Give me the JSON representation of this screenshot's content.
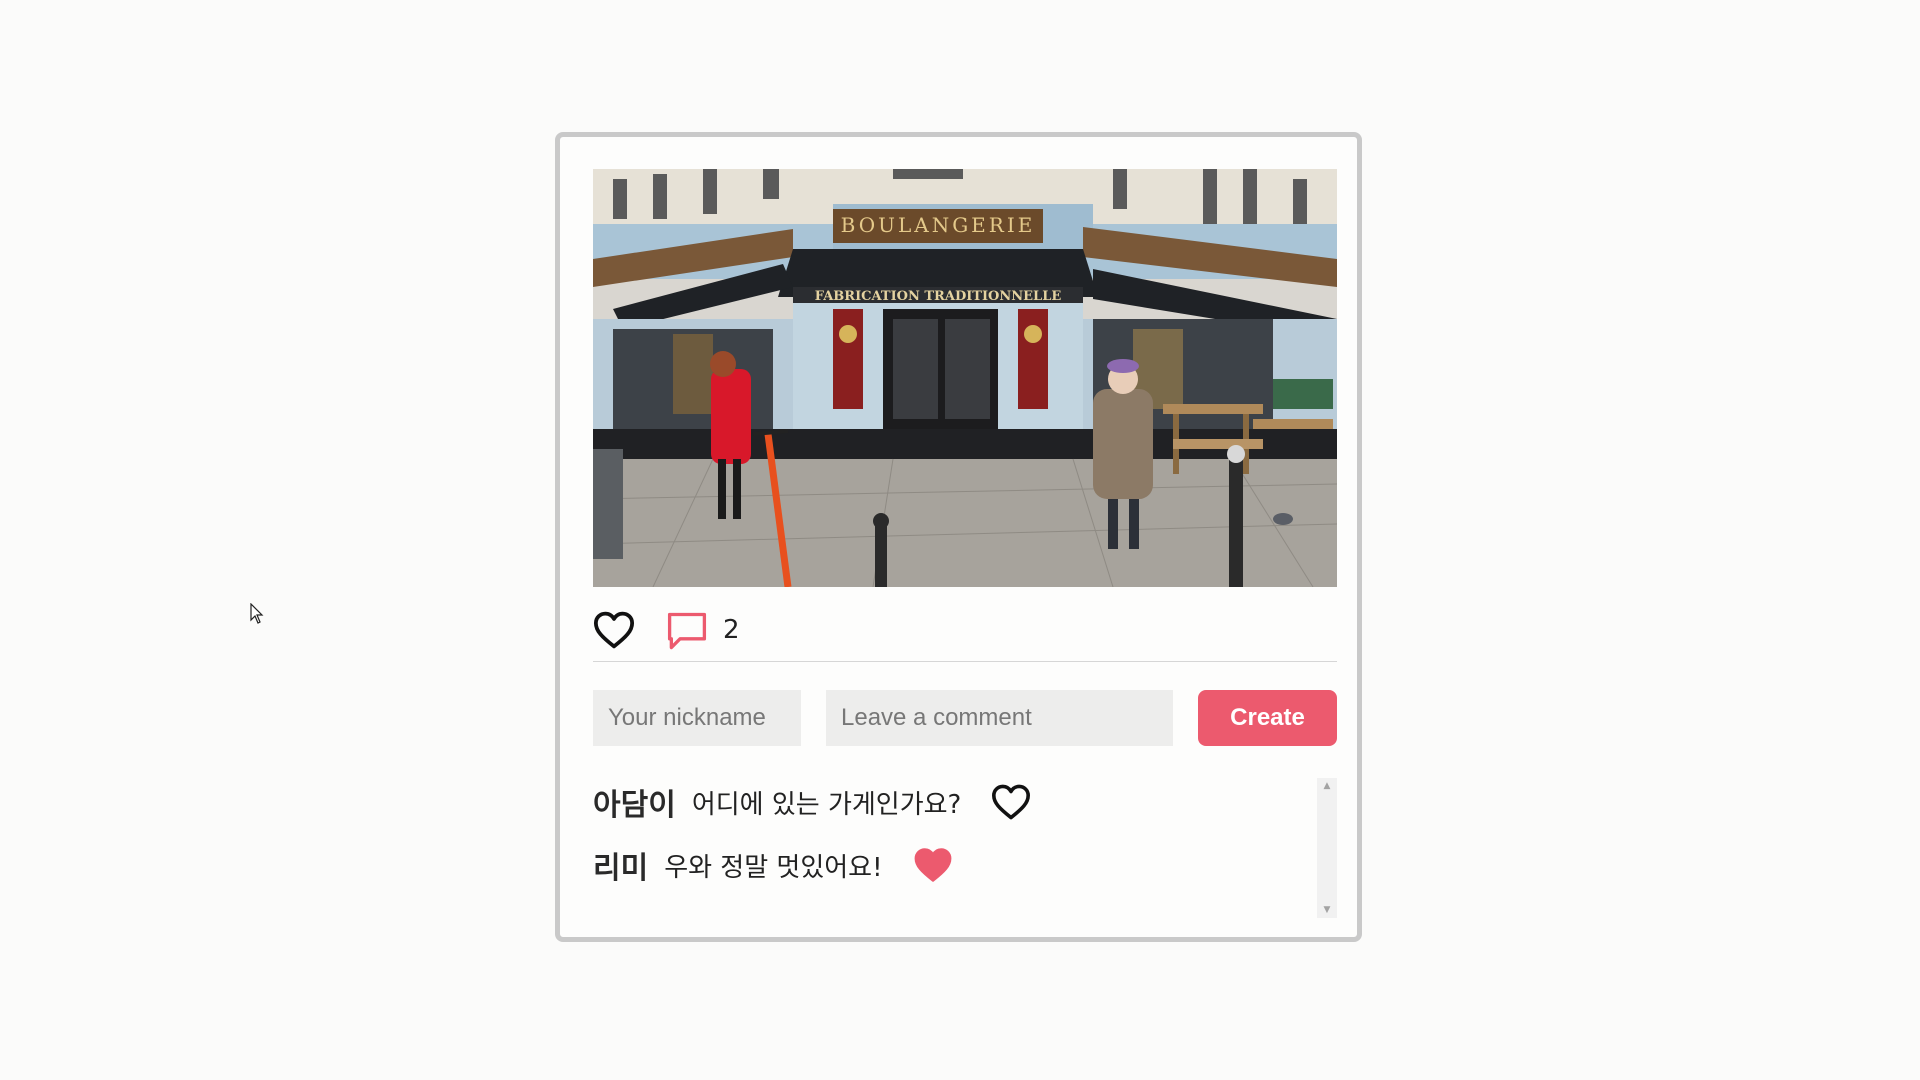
{
  "post": {
    "image_alt": "Boulangerie storefront on a Paris street corner",
    "image_signs": {
      "top": "BOULANGERIE",
      "awning": "FABRICATION TRADITIONNELLE"
    },
    "liked": false,
    "comment_count": "2"
  },
  "form": {
    "nickname_placeholder": "Your nickname",
    "comment_placeholder": "Leave a comment",
    "create_label": "Create"
  },
  "comments": [
    {
      "user": "아담이",
      "text": "어디에 있는 가게인가요?",
      "liked": false
    },
    {
      "user": "리미",
      "text": "우와 정말 멋있어요!",
      "liked": true
    }
  ],
  "colors": {
    "accent": "#ec5a6e",
    "card_border": "#c9c9c9",
    "input_bg": "#ededec",
    "background": "#fbfbfa"
  },
  "icons": [
    "heart-outline-icon",
    "comment-bubble-icon",
    "heart-filled-icon",
    "cursor-arrow-icon"
  ]
}
